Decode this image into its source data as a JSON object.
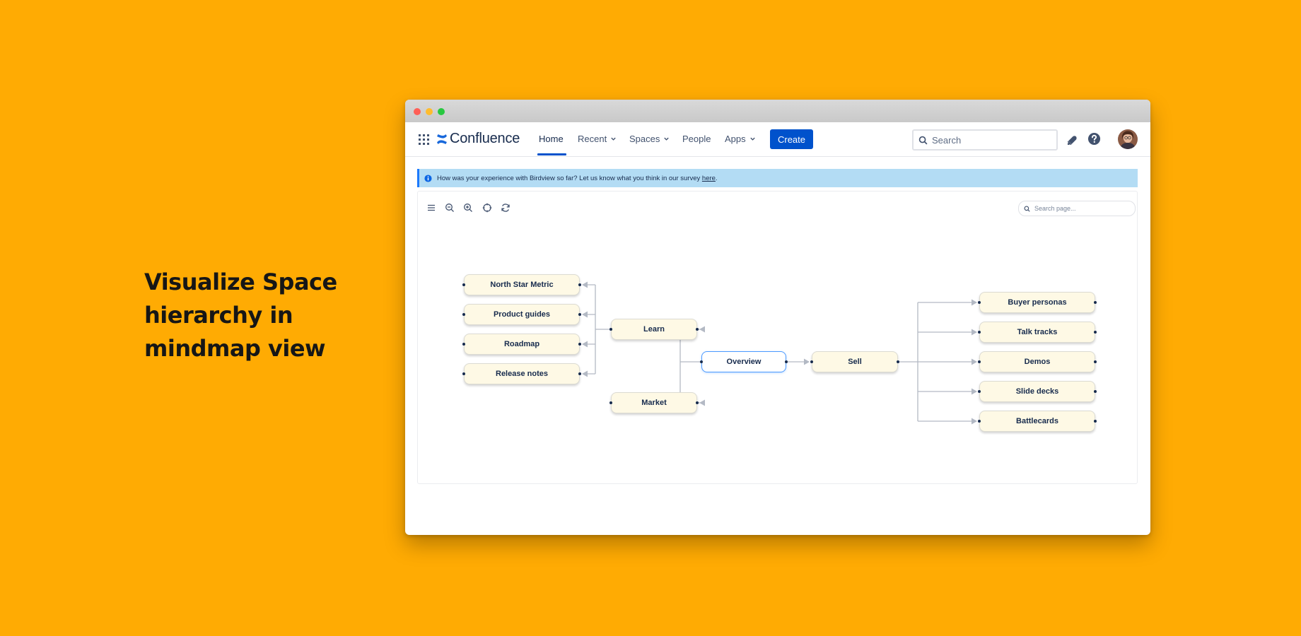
{
  "headline": {
    "lines": [
      "Visualize Space",
      "hierarchy in",
      "mindmap view"
    ]
  },
  "app": {
    "name": "Confluence",
    "nav": {
      "home": "Home",
      "recent": "Recent",
      "spaces": "Spaces",
      "people": "People",
      "apps": "Apps",
      "create": "Create"
    },
    "search_placeholder": "Search"
  },
  "banner": {
    "text": "How was your experience with Birdview so far? Let us know what you think in our survey",
    "link": "here",
    "suffix": "."
  },
  "toolbar": {
    "icons": [
      "menu-icon",
      "zoom-out-icon",
      "zoom-in-icon",
      "fit-view-icon",
      "refresh-icon"
    ],
    "page_search_placeholder": "Search page..."
  },
  "mindmap": {
    "root": "Overview",
    "left": [
      {
        "label": "Learn",
        "children": [
          "North Star Metric",
          "Product guides",
          "Roadmap",
          "Release notes"
        ]
      },
      {
        "label": "Market",
        "children": []
      }
    ],
    "right": [
      {
        "label": "Sell",
        "children": [
          "Buyer personas",
          "Talk tracks",
          "Demos",
          "Slide decks",
          "Battlecards"
        ]
      }
    ]
  },
  "colors": {
    "background": "#FFAB03",
    "brand": "#0052CC",
    "node_fill": "#FEF9E5",
    "banner": "#B3DCF4"
  }
}
